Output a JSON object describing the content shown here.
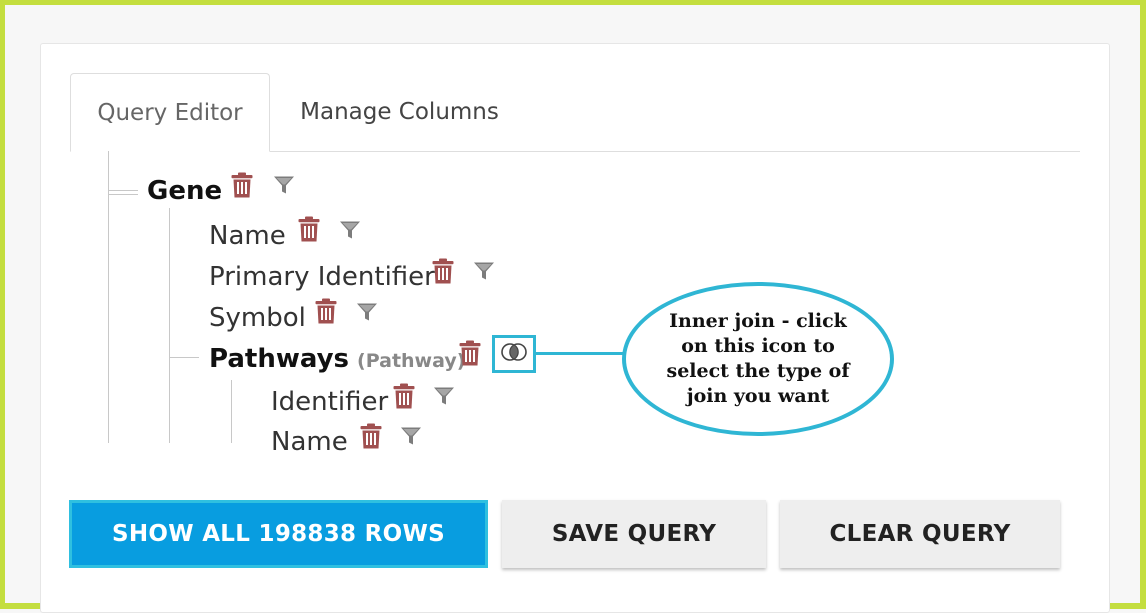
{
  "tabs": {
    "query_editor": "Query Editor",
    "manage_columns": "Manage Columns"
  },
  "tree": {
    "root": {
      "label": "Gene"
    },
    "children": [
      {
        "label": "Name"
      },
      {
        "label": "Primary Identifier"
      },
      {
        "label": "Symbol"
      }
    ],
    "pathways": {
      "label": "Pathways",
      "type": "(Pathway)",
      "children": [
        {
          "label": "Identifier"
        },
        {
          "label": "Name"
        }
      ]
    }
  },
  "icons": {
    "delete": "trash-icon",
    "filter": "filter-icon",
    "join": "venn-join-icon"
  },
  "callout": {
    "text": "Inner join - click on this icon to select the type of join you want"
  },
  "buttons": {
    "show_all": "SHOW ALL 198838 ROWS",
    "save": "SAVE QUERY",
    "clear": "CLEAR QUERY"
  },
  "colors": {
    "primary": "#089de0",
    "accent": "#2fb6d4",
    "trash": "#a05050",
    "frame": "#c4de3f"
  }
}
